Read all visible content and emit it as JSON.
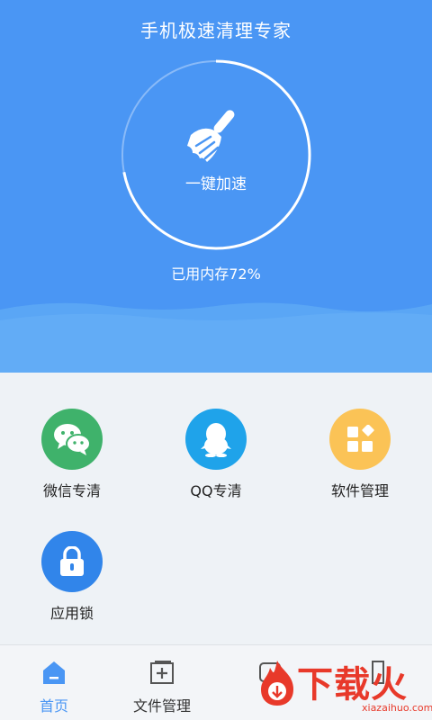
{
  "header": {
    "title": "手机极速清理专家",
    "boost_label": "一键加速",
    "memory_text": "已用内存72%",
    "memory_used_percent": 72,
    "bg_color": "#4a96f4"
  },
  "features": [
    {
      "label": "微信专清",
      "icon": "wechat-icon",
      "color": "#3fb26b"
    },
    {
      "label": "QQ专清",
      "icon": "qq-penguin-icon",
      "color": "#1fa3ea"
    },
    {
      "label": "软件管理",
      "icon": "apps-grid-icon",
      "color": "#fbc356"
    },
    {
      "label": "应用锁",
      "icon": "lock-icon",
      "color": "#3185ea"
    }
  ],
  "tabs": [
    {
      "label": "首页",
      "icon": "home-icon",
      "active": true
    },
    {
      "label": "文件管理",
      "icon": "folder-plus-icon",
      "active": false
    }
  ],
  "watermark": {
    "text": "下载火",
    "url": "xiazaihuo.com",
    "color": "#e8392a"
  }
}
